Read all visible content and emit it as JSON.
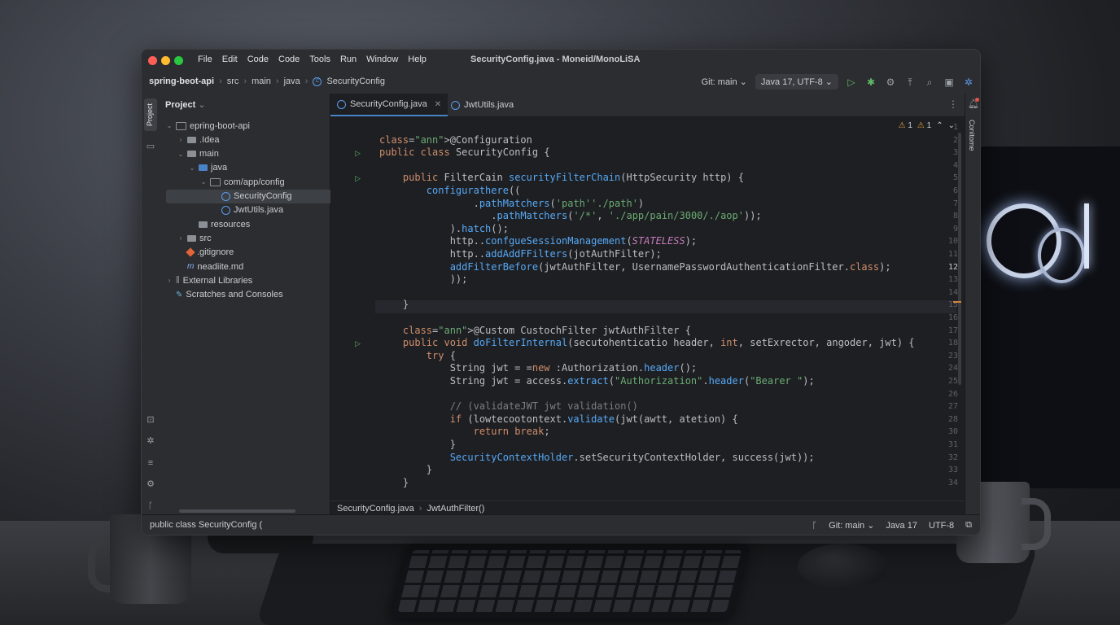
{
  "window": {
    "menu": [
      "File",
      "Edit",
      "Code",
      "Code",
      "Tools",
      "Run",
      "Window",
      "Help"
    ],
    "title": "SecurityConfig.java - Moneid/MonoLiSA"
  },
  "navbar": {
    "breadcrumb": [
      "spring-beot-api",
      "src",
      "main",
      "java",
      "SecurityConfig"
    ],
    "git_branch": "Git: main",
    "sdk_encoding": "Java 17, UTF-8"
  },
  "sidebar": {
    "strip_tab": "Project",
    "header": "Project",
    "tree": [
      {
        "label": "epring-boot-api",
        "indent": 0,
        "chevron": "v",
        "icon": "folder-outline"
      },
      {
        "label": ".Idea",
        "indent": 1,
        "chevron": ">",
        "icon": "folder"
      },
      {
        "label": "main",
        "indent": 1,
        "chevron": "v",
        "icon": "folder"
      },
      {
        "label": "java",
        "indent": 2,
        "chevron": "v",
        "icon": "folder-blue"
      },
      {
        "label": "com/app/config",
        "indent": 3,
        "chevron": "v",
        "icon": "folder-outline"
      },
      {
        "label": "SecurityConfig",
        "indent": 4,
        "chevron": "",
        "icon": "java-class",
        "selected": true
      },
      {
        "label": "JwtUtils.java",
        "indent": 4,
        "chevron": "",
        "icon": "java-class"
      },
      {
        "label": "resources",
        "indent": 2,
        "chevron": "",
        "icon": "folder"
      },
      {
        "label": "src",
        "indent": 1,
        "chevron": ">",
        "icon": "folder"
      },
      {
        "label": ".gitignore",
        "indent": 1,
        "chevron": "",
        "icon": "git"
      },
      {
        "label": "neadiite.md",
        "indent": 1,
        "chevron": "",
        "icon": "markdown"
      },
      {
        "label": "External Libraries",
        "indent": 0,
        "chevron": ">",
        "icon": "library"
      },
      {
        "label": "Scratches and Consoles",
        "indent": 0,
        "chevron": "",
        "icon": "scratch"
      }
    ]
  },
  "editor": {
    "tabs": [
      {
        "label": "SecurityConfig.java",
        "active": true
      },
      {
        "label": "JwtUtils.java",
        "active": false
      }
    ],
    "warnings": [
      "1",
      "1"
    ],
    "current_line": "12",
    "lines": [
      {
        "n": "1",
        "code": ""
      },
      {
        "n": "2",
        "code": "@Configuration"
      },
      {
        "n": "3",
        "code": "public class SecurityConfig {",
        "run": true
      },
      {
        "n": "4",
        "code": ""
      },
      {
        "n": "5",
        "code": "    public FilterCain securityFilterChain(HttpSecurity http) {",
        "run": true
      },
      {
        "n": "6",
        "code": "        configurathere(("
      },
      {
        "n": "7",
        "code": "                .pathMatchers('path''./path')"
      },
      {
        "n": "8",
        "code": "                   .pathMatchers('/*', './app/pain/3000/./aop'));"
      },
      {
        "n": "9",
        "code": "            ).hatch();"
      },
      {
        "n": "10",
        "code": "            http..confgueSessionManagement(STATELESS);"
      },
      {
        "n": "11",
        "code": "            http..addAddFFilters(jotAuthFilter);"
      },
      {
        "n": "12",
        "code": "            addFilterBefore(jwtAuthFilter, UsernamePasswordAuthenticationFilter.class);"
      },
      {
        "n": "13",
        "code": "            ));"
      },
      {
        "n": "14",
        "code": ""
      },
      {
        "n": "15",
        "code": "    }"
      },
      {
        "n": "16",
        "code": ""
      },
      {
        "n": "17",
        "code": "    @Custom CustochFilter jwtAuthFilter {"
      },
      {
        "n": "18",
        "code": "    public void doFilterInternal(secutohenticatio header, int, setExrector, angoder, jwt) {",
        "run": true
      },
      {
        "n": "23",
        "code": "        try {"
      },
      {
        "n": "24",
        "code": "            String jwt = =new :Authorization.header();"
      },
      {
        "n": "25",
        "code": "            String jwt = access.extract(\"Authorization\".header(\"Bearer \");"
      },
      {
        "n": "26",
        "code": ""
      },
      {
        "n": "27",
        "code": "            // (validateJWT jwt validation()"
      },
      {
        "n": "28",
        "code": "            if (lowtecootontext.validate(jwt(awtt, atetion) {"
      },
      {
        "n": "30",
        "code": "                return break;"
      },
      {
        "n": "31",
        "code": "            }"
      },
      {
        "n": "32",
        "code": "            SecurityContextHolder.setSecurityContextHolder, success(jwt));"
      },
      {
        "n": "33",
        "code": "        }"
      },
      {
        "n": "34",
        "code": "    }"
      }
    ],
    "breadcrumb": [
      "SecurityConfig.java",
      "JwtAuthFilter()"
    ]
  },
  "right_strip": {
    "label": "Conitome"
  },
  "status": {
    "left": "public class SecurityConfig (",
    "git": "Git: main",
    "java": "Java 17",
    "encoding": "UTF-8"
  }
}
